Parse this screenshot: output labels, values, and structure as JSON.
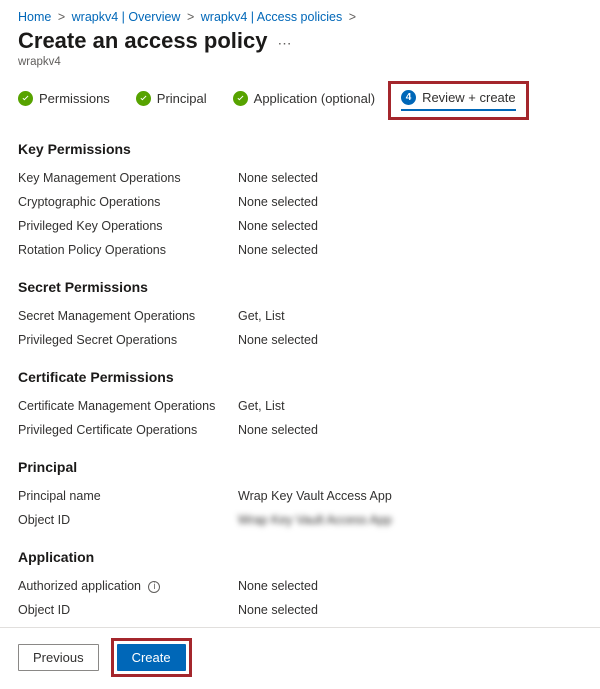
{
  "breadcrumb": {
    "items": [
      {
        "text": "Home"
      },
      {
        "text": "wrapkv4 | Overview"
      },
      {
        "text": "wrapkv4 | Access policies"
      }
    ]
  },
  "header": {
    "title": "Create an access policy",
    "subtitle": "wrapkv4"
  },
  "tabs": [
    {
      "label": "Permissions",
      "state": "done"
    },
    {
      "label": "Principal",
      "state": "done"
    },
    {
      "label": "Application (optional)",
      "state": "done"
    },
    {
      "label": "Review + create",
      "state": "current",
      "number": "4"
    }
  ],
  "sections": {
    "keyPermissions": {
      "title": "Key Permissions",
      "rows": [
        {
          "label": "Key Management Operations",
          "value": "None selected"
        },
        {
          "label": "Cryptographic Operations",
          "value": "None selected"
        },
        {
          "label": "Privileged Key Operations",
          "value": "None selected"
        },
        {
          "label": "Rotation Policy Operations",
          "value": "None selected"
        }
      ]
    },
    "secretPermissions": {
      "title": "Secret Permissions",
      "rows": [
        {
          "label": "Secret Management Operations",
          "value": "Get, List"
        },
        {
          "label": "Privileged Secret Operations",
          "value": "None selected"
        }
      ]
    },
    "certificatePermissions": {
      "title": "Certificate Permissions",
      "rows": [
        {
          "label": "Certificate Management Operations",
          "value": "Get, List"
        },
        {
          "label": "Privileged Certificate Operations",
          "value": "None selected"
        }
      ]
    },
    "principal": {
      "title": "Principal",
      "rows": [
        {
          "label": "Principal name",
          "value": "Wrap Key Vault Access App"
        },
        {
          "label": "Object ID",
          "value": "Wrap Key Vault Access App",
          "blurred": true
        }
      ]
    },
    "application": {
      "title": "Application",
      "rows": [
        {
          "label": "Authorized application",
          "value": "None selected",
          "info": true
        },
        {
          "label": "Object ID",
          "value": "None selected"
        }
      ]
    }
  },
  "footer": {
    "previous": "Previous",
    "create": "Create"
  }
}
